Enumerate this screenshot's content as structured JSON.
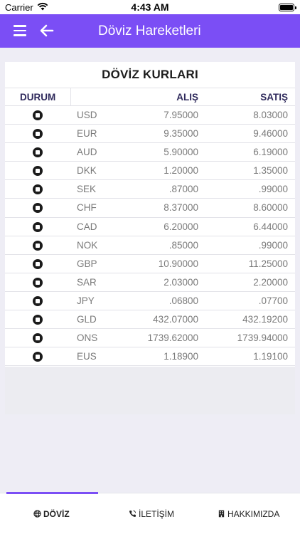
{
  "status_bar": {
    "carrier": "Carrier",
    "time": "4:43 AM"
  },
  "header": {
    "title": "Döviz Hareketleri",
    "accent": "#7b4ef5"
  },
  "table": {
    "title": "DÖVİZ KURLARI",
    "columns": {
      "durum": "DURUM",
      "alis": "ALIŞ",
      "satis": "SATIŞ"
    },
    "rows": [
      {
        "code": "USD",
        "alis": "7.95000",
        "satis": "8.03000"
      },
      {
        "code": "EUR",
        "alis": "9.35000",
        "satis": "9.46000"
      },
      {
        "code": "AUD",
        "alis": "5.90000",
        "satis": "6.19000"
      },
      {
        "code": "DKK",
        "alis": "1.20000",
        "satis": "1.35000"
      },
      {
        "code": "SEK",
        "alis": ".87000",
        "satis": ".99000"
      },
      {
        "code": "CHF",
        "alis": "8.37000",
        "satis": "8.60000"
      },
      {
        "code": "CAD",
        "alis": "6.20000",
        "satis": "6.44000"
      },
      {
        "code": "NOK",
        "alis": ".85000",
        "satis": ".99000"
      },
      {
        "code": "GBP",
        "alis": "10.90000",
        "satis": "11.25000"
      },
      {
        "code": "SAR",
        "alis": "2.03000",
        "satis": "2.20000"
      },
      {
        "code": "JPY",
        "alis": ".06800",
        "satis": ".07700"
      },
      {
        "code": "GLD",
        "alis": "432.07000",
        "satis": "432.19200"
      },
      {
        "code": "ONS",
        "alis": "1739.62000",
        "satis": "1739.94000"
      },
      {
        "code": "EUS",
        "alis": "1.18900",
        "satis": "1.19100"
      }
    ]
  },
  "bottom_nav": {
    "tabs": [
      {
        "label": "DÖVİZ",
        "icon": "globe-icon",
        "active": true
      },
      {
        "label": "İLETİŞİM",
        "icon": "phone-icon",
        "active": false
      },
      {
        "label": "HAKKIMIZDA",
        "icon": "building-icon",
        "active": false
      }
    ]
  }
}
